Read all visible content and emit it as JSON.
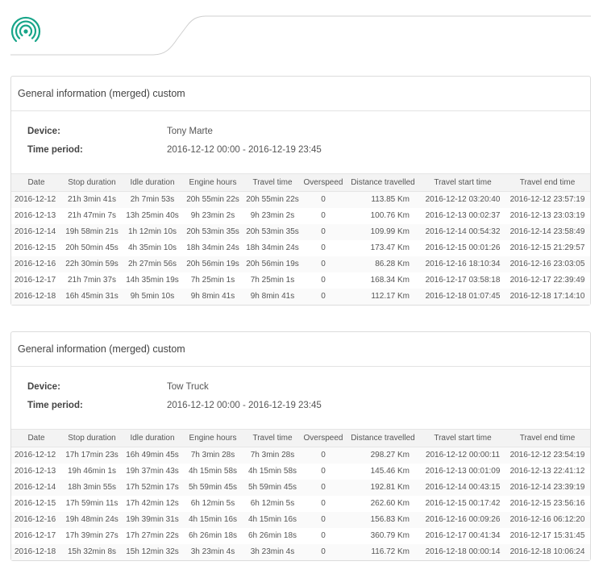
{
  "colors": {
    "logo": "#17a589",
    "border": "#dcdcdc",
    "header_bg": "#f3f3f3"
  },
  "logo_icon": "signal-rings-icon",
  "reports": [
    {
      "title": "General information (merged) custom",
      "device_label": "Device:",
      "device_value": "Tony Marte",
      "period_label": "Time period:",
      "period_value": "2016-12-12 00:00 - 2016-12-19 23:45",
      "columns": [
        "Date",
        "Stop duration",
        "Idle duration",
        "Engine hours",
        "Travel time",
        "Overspeed",
        "Distance travelled",
        "Travel start time",
        "Travel end time"
      ],
      "rows": [
        [
          "2016-12-12",
          "21h 3min 41s",
          "2h 7min 53s",
          "20h 55min 22s",
          "20h 55min 22s",
          "0",
          "113.85 Km",
          "2016-12-12 03:20:40",
          "2016-12-12 23:57:19"
        ],
        [
          "2016-12-13",
          "21h 47min 7s",
          "13h 25min 40s",
          "9h 23min 2s",
          "9h 23min 2s",
          "0",
          "100.76 Km",
          "2016-12-13 00:02:37",
          "2016-12-13 23:03:19"
        ],
        [
          "2016-12-14",
          "19h 58min 21s",
          "1h 12min 10s",
          "20h 53min 35s",
          "20h 53min 35s",
          "0",
          "109.99 Km",
          "2016-12-14 00:54:32",
          "2016-12-14 23:58:49"
        ],
        [
          "2016-12-15",
          "20h 50min 45s",
          "4h 35min 10s",
          "18h 34min 24s",
          "18h 34min 24s",
          "0",
          "173.47 Km",
          "2016-12-15 00:01:26",
          "2016-12-15 21:29:57"
        ],
        [
          "2016-12-16",
          "22h 30min 59s",
          "2h 27min 56s",
          "20h 56min 19s",
          "20h 56min 19s",
          "0",
          "86.28 Km",
          "2016-12-16 18:10:34",
          "2016-12-16 23:03:05"
        ],
        [
          "2016-12-17",
          "21h 7min 37s",
          "14h 35min 19s",
          "7h 25min 1s",
          "7h 25min 1s",
          "0",
          "168.34 Km",
          "2016-12-17 03:58:18",
          "2016-12-17 22:39:49"
        ],
        [
          "2016-12-18",
          "16h 45min 31s",
          "9h 5min 10s",
          "9h 8min 41s",
          "9h 8min 41s",
          "0",
          "112.17 Km",
          "2016-12-18 01:07:45",
          "2016-12-18 17:14:10"
        ]
      ]
    },
    {
      "title": "General information (merged) custom",
      "device_label": "Device:",
      "device_value": "Tow Truck",
      "period_label": "Time period:",
      "period_value": "2016-12-12 00:00 - 2016-12-19 23:45",
      "columns": [
        "Date",
        "Stop duration",
        "Idle duration",
        "Engine hours",
        "Travel time",
        "Overspeed",
        "Distance travelled",
        "Travel start time",
        "Travel end time"
      ],
      "rows": [
        [
          "2016-12-12",
          "17h 17min 23s",
          "16h 49min 45s",
          "7h 3min 28s",
          "7h 3min 28s",
          "0",
          "298.27 Km",
          "2016-12-12 00:00:11",
          "2016-12-12 23:54:19"
        ],
        [
          "2016-12-13",
          "19h 46min 1s",
          "19h 37min 43s",
          "4h 15min 58s",
          "4h 15min 58s",
          "0",
          "145.46 Km",
          "2016-12-13 00:01:09",
          "2016-12-13 22:41:12"
        ],
        [
          "2016-12-14",
          "18h 3min 55s",
          "17h 52min 17s",
          "5h 59min 45s",
          "5h 59min 45s",
          "0",
          "192.81 Km",
          "2016-12-14 00:43:15",
          "2016-12-14 23:39:19"
        ],
        [
          "2016-12-15",
          "17h 59min 11s",
          "17h 42min 12s",
          "6h 12min 5s",
          "6h 12min 5s",
          "0",
          "262.60 Km",
          "2016-12-15 00:17:42",
          "2016-12-15 23:56:16"
        ],
        [
          "2016-12-16",
          "19h 48min 24s",
          "19h 39min 31s",
          "4h 15min 16s",
          "4h 15min 16s",
          "0",
          "156.83 Km",
          "2016-12-16 00:09:26",
          "2016-12-16 06:12:20"
        ],
        [
          "2016-12-17",
          "17h 39min 27s",
          "17h 27min 22s",
          "6h 26min 18s",
          "6h 26min 18s",
          "0",
          "360.79 Km",
          "2016-12-17 00:41:34",
          "2016-12-17 15:31:45"
        ],
        [
          "2016-12-18",
          "15h 32min 8s",
          "15h 12min 32s",
          "3h 23min 4s",
          "3h 23min 4s",
          "0",
          "116.72 Km",
          "2016-12-18 00:00:14",
          "2016-12-18 10:06:24"
        ]
      ]
    }
  ]
}
